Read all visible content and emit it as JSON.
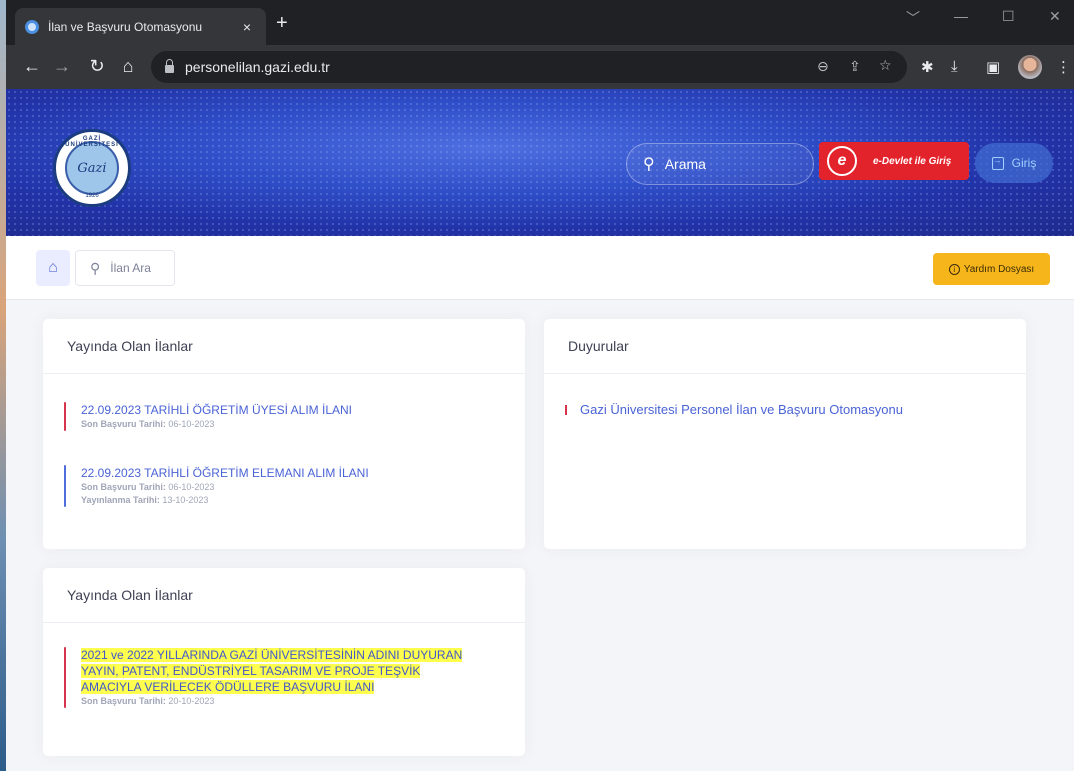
{
  "browser": {
    "tab_title": "İlan ve Başvuru Otomasyonu",
    "tab_close": "×",
    "new_tab": "+",
    "url": "personelilan.gazi.edu.tr",
    "window_controls": [
      "﹀",
      "—",
      "☐",
      "✕"
    ]
  },
  "header": {
    "logo_ring": "GAZİ ÜNİVERSİTESİ",
    "logo_sign": "Gazi",
    "logo_year": "1926",
    "search_placeholder": "Arama",
    "edevlet_label": "e-Devlet ile Giriş",
    "edevlet_mark": "e",
    "login_label": "Giriş"
  },
  "subbar": {
    "search_label": "İlan Ara",
    "help_label": "Yardım Dosyası"
  },
  "cards": {
    "listings1": {
      "title": "Yayında Olan İlanlar",
      "items": [
        {
          "title": "22.09.2023 TARİHLİ ÖĞRETİM ÜYESİ ALIM İLANI",
          "deadline_label": "Son Başvuru Tarihi:",
          "deadline": "06-10-2023"
        },
        {
          "title": "22.09.2023 TARİHLİ ÖĞRETİM ELEMANI ALIM İLANI",
          "deadline_label": "Son Başvuru Tarihi:",
          "deadline": "06-10-2023",
          "publish_label": "Yayınlanma Tarihi:",
          "publish": "13-10-2023"
        }
      ]
    },
    "announcements": {
      "title": "Duyurular",
      "items": [
        "Gazi Üniversitesi Personel İlan ve Başvuru Otomasyonu"
      ]
    },
    "listings2": {
      "title": "Yayında Olan İlanlar",
      "items": [
        {
          "title_lines": [
            "2021 ve 2022 YILLARINDA GAZİ ÜNİVERSİTESİNİN ADINI DUYURAN",
            "YAYIN, PATENT, ENDÜSTRİYEL TASARIM VE PROJE TEŞVİK",
            "AMACIYLA VERİLECEK ÖDÜLLERE BAŞVURU İLANI"
          ],
          "deadline_label": "Son Başvuru Tarihi:",
          "deadline": "20-10-2023"
        }
      ]
    }
  },
  "colors": {
    "header_blue": "#2f4fc9",
    "link_blue": "#4a63d5",
    "accent_red": "#d6334c",
    "help_yellow": "#f6b51b",
    "highlight": "#ffff4d"
  }
}
